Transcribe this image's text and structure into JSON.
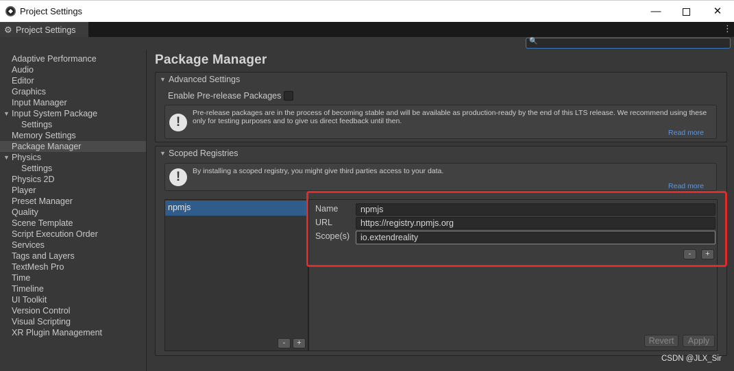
{
  "window": {
    "title": "Project Settings",
    "minimize": "—",
    "close": "✕"
  },
  "tab": {
    "label": "Project Settings",
    "menu_glyph": "⋮"
  },
  "search": {
    "value": "",
    "placeholder": ""
  },
  "sidebar": {
    "items": [
      {
        "label": "Adaptive Performance"
      },
      {
        "label": "Audio"
      },
      {
        "label": "Editor"
      },
      {
        "label": "Graphics"
      },
      {
        "label": "Input Manager"
      },
      {
        "label": "Input System Package",
        "expanded": true
      },
      {
        "label": "Settings",
        "child": true
      },
      {
        "label": "Memory Settings"
      },
      {
        "label": "Package Manager",
        "active": true
      },
      {
        "label": "Physics",
        "expanded": true
      },
      {
        "label": "Settings",
        "child": true
      },
      {
        "label": "Physics 2D"
      },
      {
        "label": "Player"
      },
      {
        "label": "Preset Manager"
      },
      {
        "label": "Quality"
      },
      {
        "label": "Scene Template"
      },
      {
        "label": "Script Execution Order"
      },
      {
        "label": "Services"
      },
      {
        "label": "Tags and Layers"
      },
      {
        "label": "TextMesh Pro"
      },
      {
        "label": "Time"
      },
      {
        "label": "Timeline"
      },
      {
        "label": "UI Toolkit"
      },
      {
        "label": "Version Control"
      },
      {
        "label": "Visual Scripting"
      },
      {
        "label": "XR Plugin Management"
      }
    ]
  },
  "main": {
    "title": "Package Manager",
    "advanced": {
      "header": "Advanced Settings",
      "prerelease_label": "Enable Pre-release Packages",
      "prerelease_checked": false,
      "help_text": "Pre-release packages are in the process of becoming stable and will be available as production-ready by the end of this LTS release. We recommend using these only for testing purposes and to give us direct feedback until then.",
      "read_more": "Read more"
    },
    "scoped": {
      "header": "Scoped Registries",
      "help_text": "By installing a scoped registry, you might give third parties access to your data.",
      "read_more": "Read more",
      "registries": [
        "npmjs"
      ],
      "list_minus": "-",
      "list_plus": "+",
      "detail": {
        "name_label": "Name",
        "name_value": "npmjs",
        "url_label": "URL",
        "url_value": "https://registry.npmjs.org",
        "scope_label": "Scope(s)",
        "scope_value": "io.extendreality",
        "scope_minus": "-",
        "scope_plus": "+",
        "revert_label": "Revert",
        "apply_label": "Apply"
      }
    }
  },
  "watermark": "CSDN @JLX_Sir",
  "colors": {
    "highlight": "#e12a2a",
    "selection": "#2f5c8a",
    "link": "#5c95e0"
  }
}
